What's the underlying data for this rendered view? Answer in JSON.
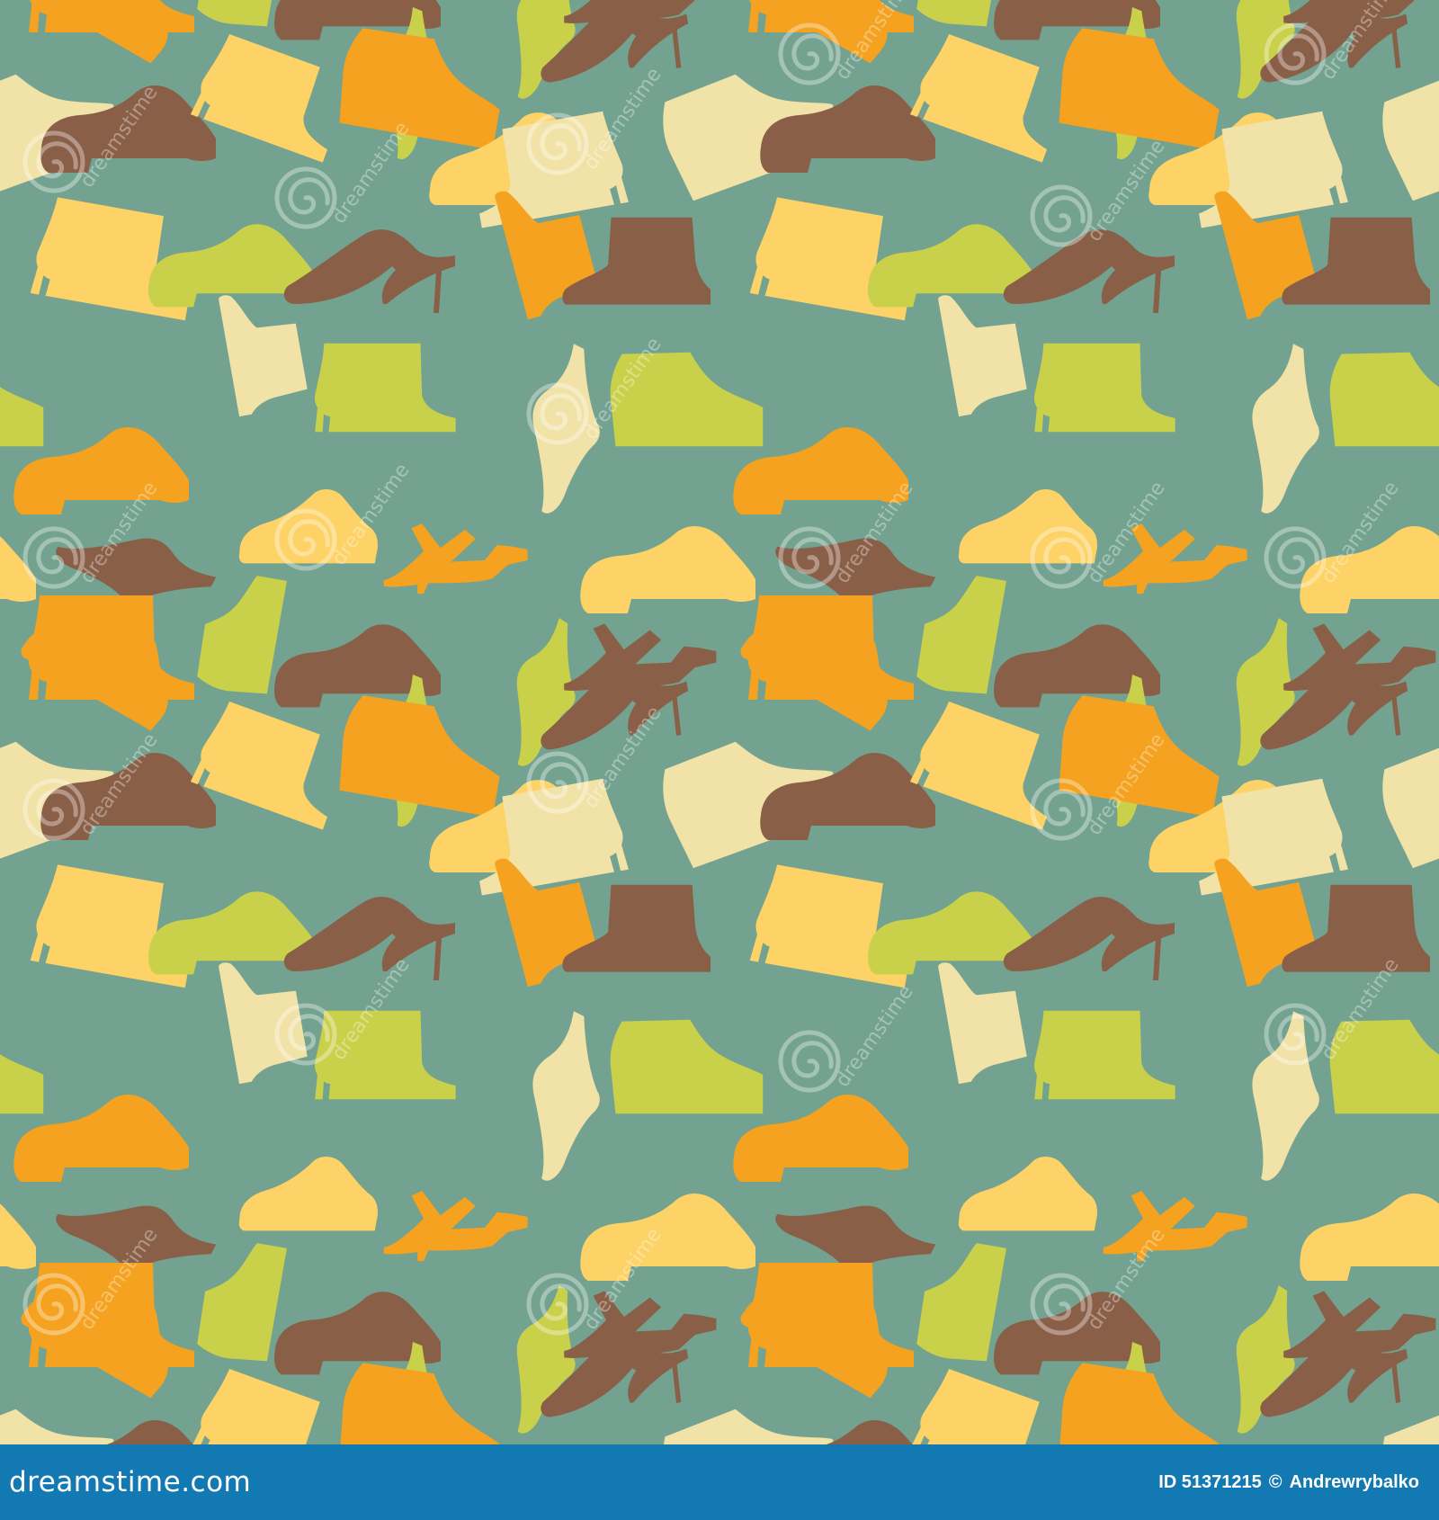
{
  "pattern": {
    "background_color": "#73a290",
    "shoe_colors": {
      "brown": "#8a5f47",
      "orange": "#f4a21f",
      "yellow": "#fdd266",
      "cream": "#f1e2a7",
      "lime": "#c9d04a"
    },
    "shoe_types": [
      "high-heel",
      "sneaker",
      "boot",
      "oxford",
      "ankle-boot",
      "stiletto",
      "sandal",
      "hiker"
    ],
    "watermark_text": "dreamstime",
    "watermark_icon": "spiral-logo-icon"
  },
  "footer": {
    "background_color": "#1279b3",
    "domain_text": "dreamstime.com",
    "id_text": "ID 51371215",
    "copyright_symbol": "©",
    "author_text": "Andrewrybalko"
  }
}
